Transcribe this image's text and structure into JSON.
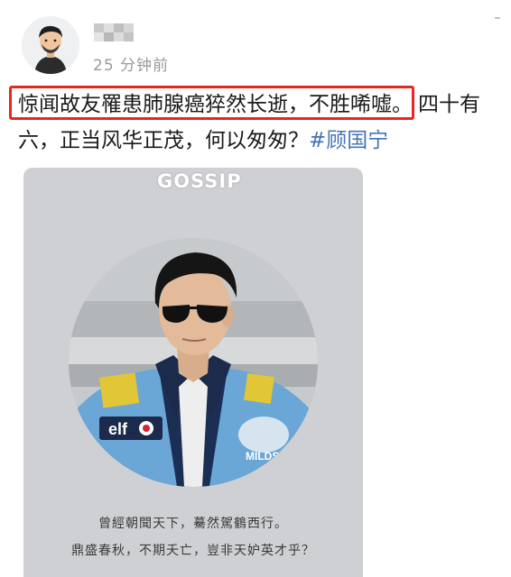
{
  "header": {
    "time_ago": "25 分钟前",
    "avatar_icon": "cartoon-avatar-icon",
    "username_obscured": true
  },
  "post": {
    "highlighted_text": "惊闻故友罹患肺腺癌猝然长逝，不胜唏嘘。",
    "line1_rest": "四十有",
    "line2_text": "六，正当风华正茂，何以匆匆？",
    "hashtag": "#顾国宁",
    "highlight_color": "#e6281e",
    "link_color": "#4474b5"
  },
  "card": {
    "watermark": "GOSSIP",
    "caption_line1": "曾經朝聞天下，驀然駕鶴西行。",
    "caption_line2": "鼎盛春秋，不期夭亡，豈非天妒英才乎？",
    "jacket_sponsor": "elf",
    "jacket_logo": "MILDSE"
  }
}
